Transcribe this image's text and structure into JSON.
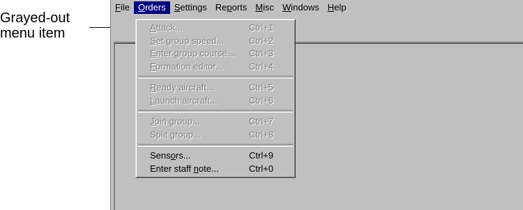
{
  "callout": {
    "line1": "Grayed-out",
    "line2": "menu item"
  },
  "menubar": [
    {
      "pre": "",
      "acc": "F",
      "post": "ile"
    },
    {
      "pre": "",
      "acc": "O",
      "post": "rders",
      "active": true
    },
    {
      "pre": "",
      "acc": "S",
      "post": "ettings"
    },
    {
      "pre": "Re",
      "acc": "p",
      "post": "orts"
    },
    {
      "pre": "",
      "acc": "M",
      "post": "isc"
    },
    {
      "pre": "",
      "acc": "W",
      "post": "indows"
    },
    {
      "pre": "",
      "acc": "H",
      "post": "elp"
    }
  ],
  "menu": {
    "groups": [
      [
        {
          "pre": "",
          "acc": "A",
          "post": "ttack...",
          "shortcut": "Ctrl+1",
          "enabled": false
        },
        {
          "pre": "",
          "acc": "S",
          "post": "et group speed...",
          "shortcut": "Ctrl+2",
          "enabled": false
        },
        {
          "pre": "",
          "acc": "E",
          "post": "nter group course...",
          "shortcut": "Ctrl+3",
          "enabled": false
        },
        {
          "pre": "",
          "acc": "F",
          "post": "ormation editor...",
          "shortcut": "Ctrl+4",
          "enabled": false
        }
      ],
      [
        {
          "pre": "",
          "acc": "R",
          "post": "eady aircraft...",
          "shortcut": "Ctrl+5",
          "enabled": false
        },
        {
          "pre": "",
          "acc": "L",
          "post": "aunch aircraft...",
          "shortcut": "Ctrl+6",
          "enabled": false
        }
      ],
      [
        {
          "pre": "",
          "acc": "J",
          "post": "oin group...",
          "shortcut": "Ctrl+7",
          "enabled": false
        },
        {
          "pre": "Split ",
          "acc": "g",
          "post": "roup...",
          "shortcut": "Ctrl+8",
          "enabled": false
        }
      ],
      [
        {
          "pre": "Sens",
          "acc": "o",
          "post": "rs...",
          "shortcut": "Ctrl+9",
          "enabled": true
        },
        {
          "pre": "Enter staff ",
          "acc": "n",
          "post": "ote...",
          "shortcut": "Ctrl+0",
          "enabled": true
        }
      ]
    ]
  }
}
